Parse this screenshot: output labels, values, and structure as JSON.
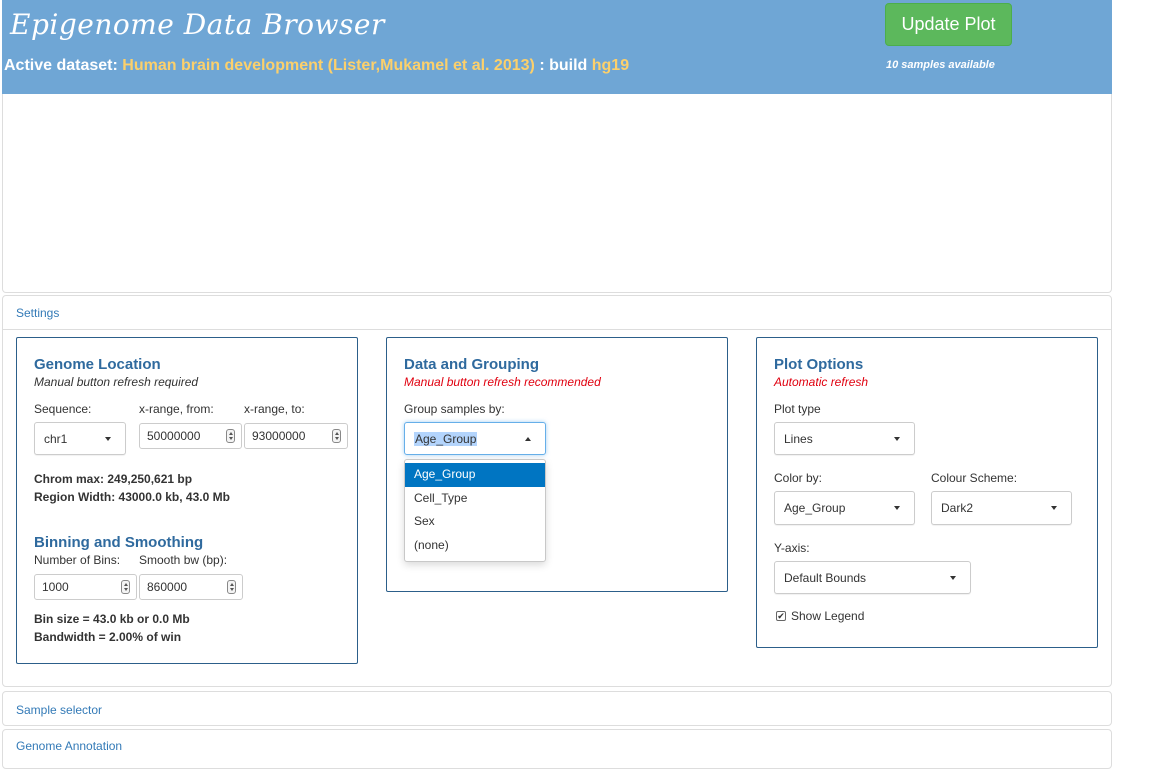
{
  "header": {
    "app_title": "Epigenome Data Browser",
    "active_prefix": "Active dataset:",
    "dataset_name": "Human brain development (Lister,Mukamel et al. 2013)",
    "build_prefix": ": build",
    "build": "hg19",
    "update_button": "Update Plot",
    "samples_available": "10 samples available",
    "colors": {
      "header_bg": "#6fa6d5",
      "highlight": "#fcd06b",
      "update_button": "#5cb85c"
    }
  },
  "panels": {
    "settings": "Settings",
    "sample_selector": "Sample selector",
    "genome_annotation": "Genome Annotation"
  },
  "genome_location": {
    "title": "Genome Location",
    "subtitle": "Manual button refresh required",
    "sequence_label": "Sequence:",
    "sequence_value": "chr1",
    "xfrom_label": "x-range, from:",
    "xfrom_value": "50000000",
    "xto_label": "x-range, to:",
    "xto_value": "93000000",
    "chrom_max": "Chrom max: 249,250,621 bp",
    "region_width": "Region Width: 43000.0 kb, 43.0 Mb"
  },
  "binning": {
    "title": "Binning and Smoothing",
    "bins_label": "Number of Bins:",
    "bins_value": "1000",
    "smooth_label": "Smooth bw (bp):",
    "smooth_value": "860000",
    "bin_size": "Bin size = 43.0 kb or 0.0 Mb",
    "bandwidth": "Bandwidth = 2.00% of win"
  },
  "data_grouping": {
    "title": "Data and Grouping",
    "subtitle": "Manual button refresh recommended",
    "group_label": "Group samples by:",
    "group_value": "Age_Group",
    "options": [
      "Age_Group",
      "Cell_Type",
      "Sex",
      "(none)"
    ]
  },
  "plot_options": {
    "title": "Plot Options",
    "subtitle": "Automatic refresh",
    "plot_type_label": "Plot type",
    "plot_type_value": "Lines",
    "color_by_label": "Color by:",
    "color_by_value": "Age_Group",
    "scheme_label": "Colour Scheme:",
    "scheme_value": "Dark2",
    "yaxis_label": "Y-axis:",
    "yaxis_value": "Default Bounds",
    "legend_label": "Show Legend",
    "legend_checked": true
  }
}
